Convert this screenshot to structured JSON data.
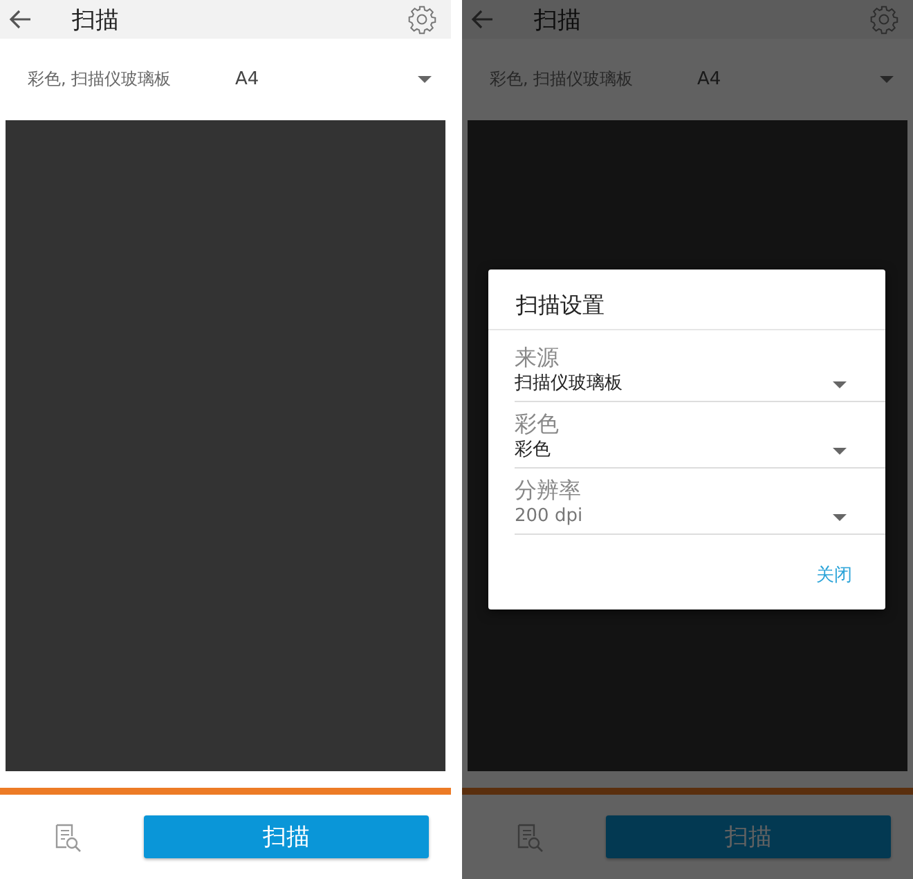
{
  "screens": [
    {
      "title": "扫描",
      "summary": "彩色, 扫描仪玻璃板",
      "paper_size": "A4",
      "scan_button": "扫描"
    },
    {
      "title": "扫描",
      "summary": "彩色, 扫描仪玻璃板",
      "paper_size": "A4",
      "scan_button": "扫描",
      "dialog": {
        "title": "扫描设置",
        "fields": [
          {
            "label": "来源",
            "value": "扫描仪玻璃板",
            "disabled": false
          },
          {
            "label": "彩色",
            "value": "彩色",
            "disabled": false
          },
          {
            "label": "分辨率",
            "value": "200 dpi",
            "disabled": true
          }
        ],
        "close_button": "关闭"
      }
    }
  ]
}
